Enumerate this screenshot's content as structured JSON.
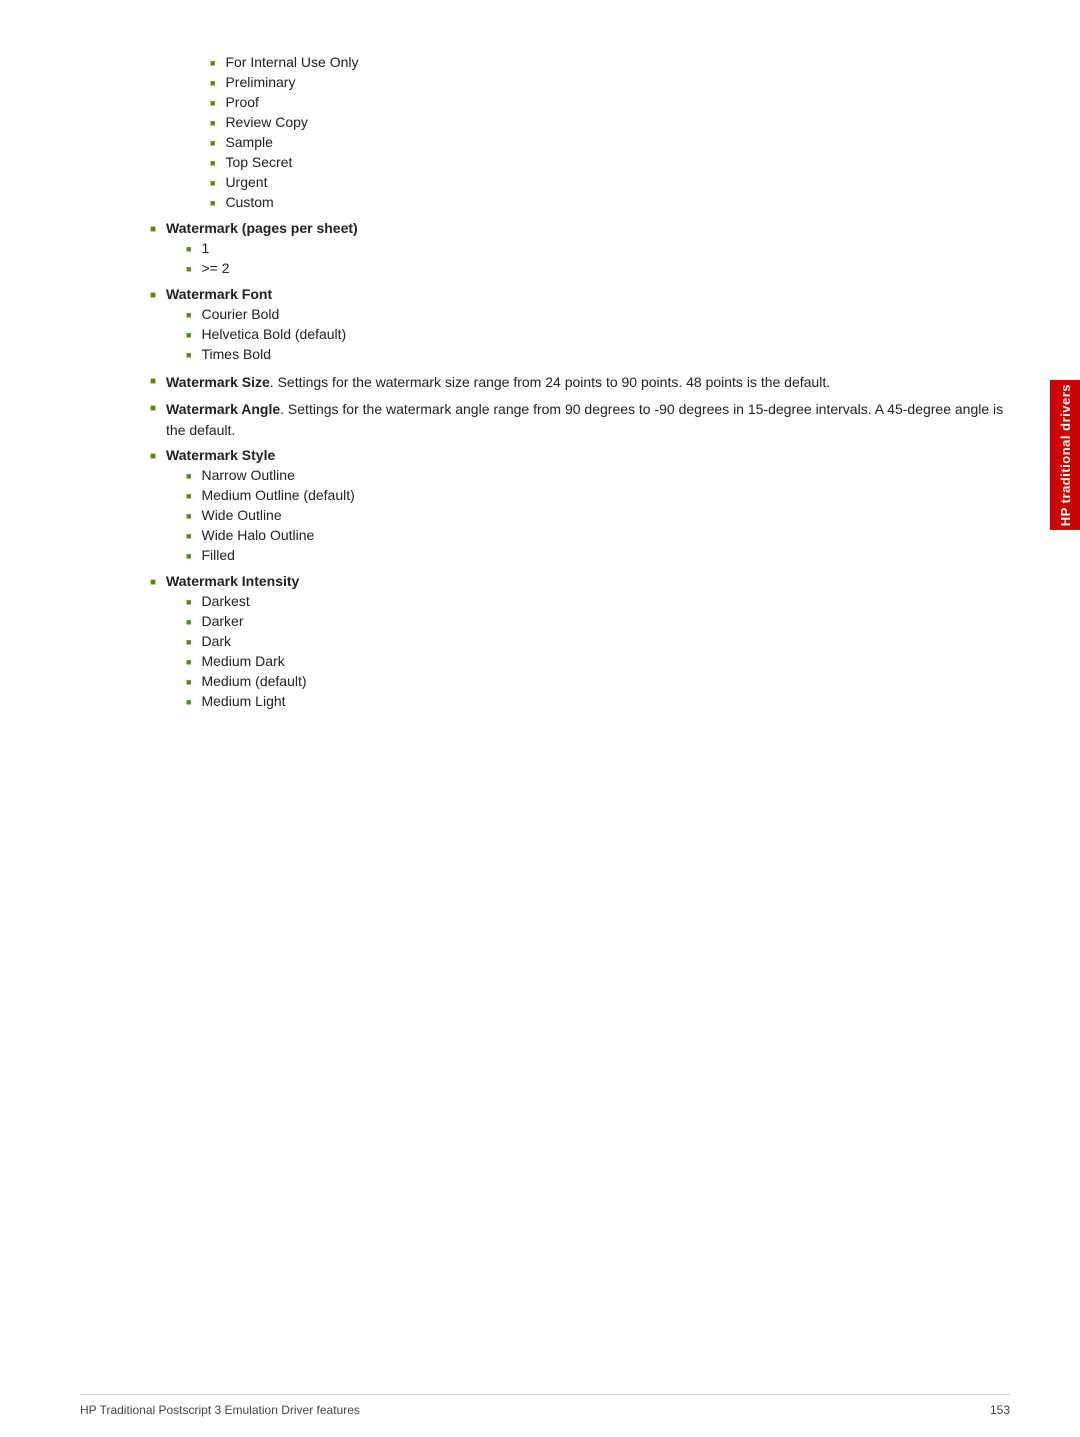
{
  "sideTab": {
    "label": "HP traditional drivers"
  },
  "content": {
    "subItems1": [
      "For Internal Use Only",
      "Preliminary",
      "Proof",
      "Review Copy",
      "Sample",
      "Top Secret",
      "Urgent",
      "Custom"
    ],
    "sections": [
      {
        "id": "watermark-pages",
        "label": "Watermark (pages per sheet)",
        "isBold": true,
        "subItems": [
          "1",
          ">= 2"
        ]
      },
      {
        "id": "watermark-font",
        "label": "Watermark Font",
        "isBold": true,
        "subItems": [
          "Courier Bold",
          "Helvetica Bold (default)",
          "Times Bold"
        ]
      },
      {
        "id": "watermark-size",
        "label": "Watermark Size",
        "isBold": true,
        "description": ". Settings for the watermark size range from 24 points to 90 points. 48 points is the default.",
        "subItems": []
      },
      {
        "id": "watermark-angle",
        "label": "Watermark Angle",
        "isBold": true,
        "description": ". Settings for the watermark angle range from 90 degrees to -90 degrees in 15-degree intervals. A 45-degree angle is the default.",
        "subItems": []
      },
      {
        "id": "watermark-style",
        "label": "Watermark Style",
        "isBold": true,
        "subItems": [
          "Narrow Outline",
          "Medium Outline (default)",
          "Wide Outline",
          "Wide Halo Outline",
          "Filled"
        ]
      },
      {
        "id": "watermark-intensity",
        "label": "Watermark Intensity",
        "isBold": true,
        "subItems": [
          "Darkest",
          "Darker",
          "Dark",
          "Medium Dark",
          "Medium (default)",
          "Medium Light"
        ]
      }
    ]
  },
  "footer": {
    "left": "HP Traditional Postscript 3 Emulation Driver features",
    "right": "153"
  }
}
